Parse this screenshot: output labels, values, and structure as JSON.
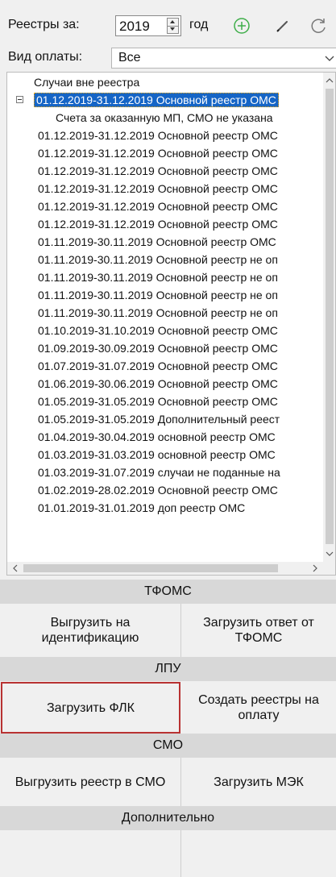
{
  "toolbar": {
    "year_label": "Реестры за:",
    "year_value": "2019",
    "year_unit": "год",
    "add_icon": "plus-circle-icon",
    "edit_icon": "pencil-icon",
    "refresh_icon": "refresh-icon"
  },
  "payment": {
    "label": "Вид оплаты:",
    "value": "Все"
  },
  "tree": {
    "items": [
      "Случаи вне реестра",
      "01.12.2019-31.12.2019 Основной реестр ОМС",
      "Счета за оказанную МП, СМО не указана",
      "01.12.2019-31.12.2019 Основной реестр ОМС",
      "01.12.2019-31.12.2019 Основной реестр ОМС",
      "01.12.2019-31.12.2019 Основной реестр ОМС",
      "01.12.2019-31.12.2019 Основной реестр ОМС",
      "01.12.2019-31.12.2019 Основной реестр ОМС",
      "01.12.2019-31.12.2019 Основной реестр ОМС",
      "01.11.2019-30.11.2019 Основной реестр ОМС",
      "01.11.2019-30.11.2019 Основной реестр не оп",
      "01.11.2019-30.11.2019 Основной реестр не оп",
      "01.11.2019-30.11.2019 Основной реестр не оп",
      "01.11.2019-30.11.2019 Основной реестр не оп",
      "01.10.2019-31.10.2019 Основной реестр ОМС",
      "01.09.2019-30.09.2019 Основной реестр ОМС",
      "01.07.2019-31.07.2019 Основной реестр ОМС",
      "01.06.2019-30.06.2019 Основной реестр ОМС",
      "01.05.2019-31.05.2019 Основной реестр ОМС",
      "01.05.2019-31.05.2019 Дополнительный реест",
      "01.04.2019-30.04.2019 основной реестр ОМС",
      "01.03.2019-31.03.2019 основной реестр ОМС",
      "01.03.2019-31.07.2019 случаи не поданные на",
      "01.02.2019-28.02.2019 Основной реестр ОМС",
      "01.01.2019-31.01.2019 доп реестр ОМС"
    ]
  },
  "sections": {
    "tfoms": {
      "title": "ТФОМС",
      "btn_export": "Выгрузить на идентификацию",
      "btn_import": "Загрузить ответ от ТФОМС"
    },
    "lpu": {
      "title": "ЛПУ",
      "btn_flk": "Загрузить ФЛК",
      "btn_create": "Создать реестры на оплату"
    },
    "smo": {
      "title": "СМО",
      "btn_export": "Выгрузить реестр в СМО",
      "btn_mek": "Загрузить МЭК"
    },
    "extra": {
      "title": "Дополнительно"
    }
  }
}
